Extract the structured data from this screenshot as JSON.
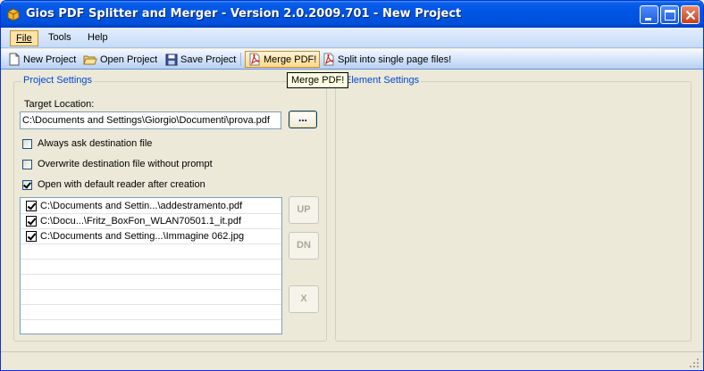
{
  "window": {
    "title": "Gios PDF Splitter and Merger - Version 2.0.2009.701 -  New Project",
    "colors": {
      "titlebar": "#0055e5",
      "group_caption": "#0046d5",
      "tooltip_bg": "#ffffe1"
    }
  },
  "menu": {
    "items": [
      {
        "label": "File",
        "active": true
      },
      {
        "label": "Tools",
        "active": false
      },
      {
        "label": "Help",
        "active": false
      }
    ]
  },
  "toolbar": {
    "new_project": {
      "label": "New Project",
      "icon": "new-document-icon"
    },
    "open_project": {
      "label": "Open Project",
      "icon": "open-folder-icon"
    },
    "save_project": {
      "label": "Save Project",
      "icon": "floppy-disk-icon"
    },
    "merge_pdf": {
      "label": "Merge PDF!",
      "icon": "pdf-icon"
    },
    "split_pdf": {
      "label": "Split into single page files!",
      "icon": "pdf-icon"
    }
  },
  "tooltip": {
    "text": "Merge PDF!"
  },
  "project_settings": {
    "caption": "Project Settings",
    "target_label": "Target Location:",
    "target_value": "C:\\Documents and Settings\\Giorgio\\Documenti\\prova.pdf",
    "browse_label": "...",
    "options": [
      {
        "label": "Always ask destination file",
        "checked": false
      },
      {
        "label": "Overwrite destination file without prompt",
        "checked": false
      },
      {
        "label": "Open with default reader after creation",
        "checked": true
      }
    ],
    "files": [
      {
        "path": "C:\\Documents and Settin...\\addestramento.pdf",
        "checked": true
      },
      {
        "path": "C:\\Docu...\\Fritz_BoxFon_WLAN70501.1_it.pdf",
        "checked": true
      },
      {
        "path": "C:\\Documents and Setting...\\Immagine 062.jpg",
        "checked": true
      }
    ],
    "buttons": {
      "up": "UP",
      "down": "DN",
      "remove": "X"
    }
  },
  "element_settings": {
    "caption": "Element Settings"
  }
}
